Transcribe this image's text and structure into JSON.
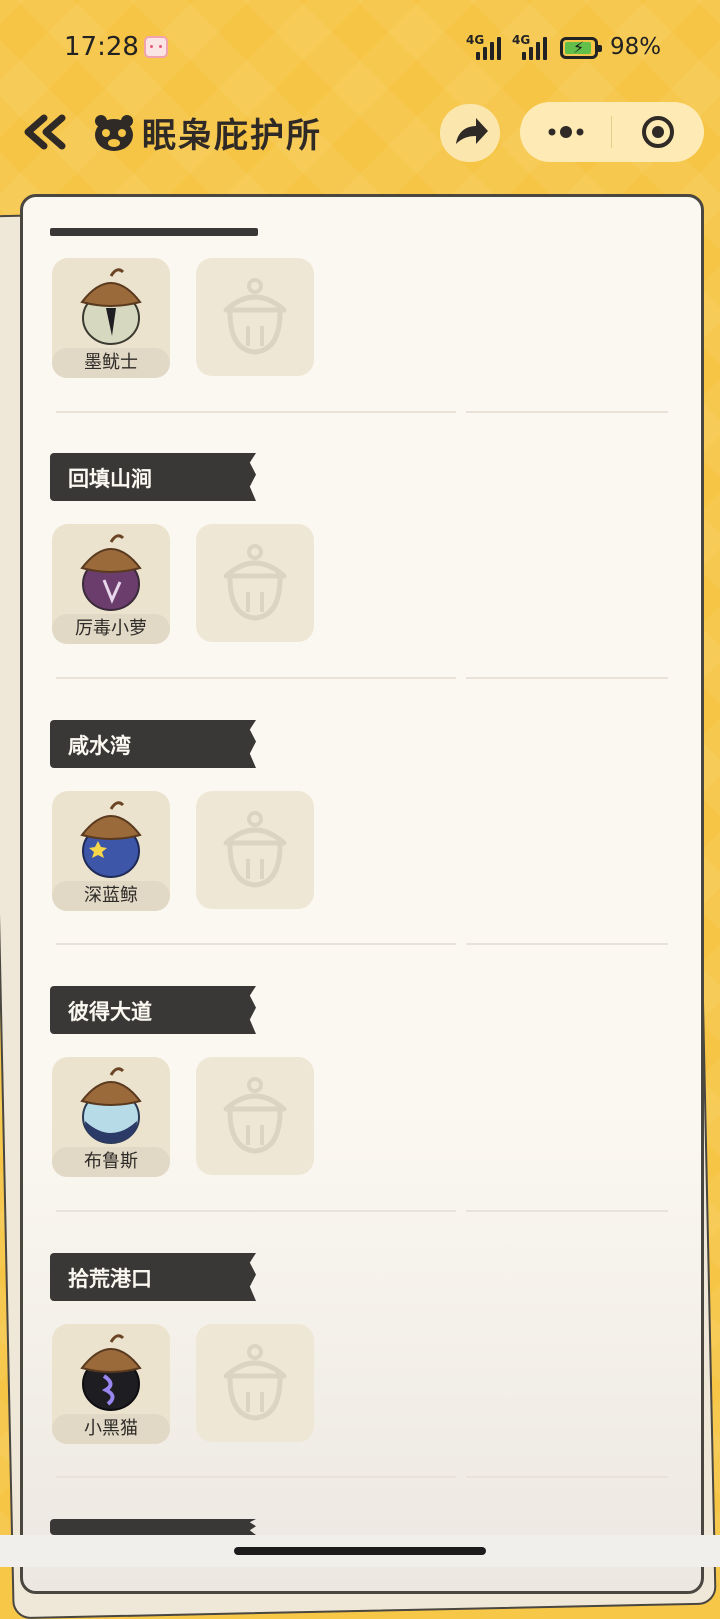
{
  "status_bar": {
    "time": "17:28",
    "net1": "4G",
    "net2": "4G",
    "battery": "98%"
  },
  "nav": {
    "title": "眠枭庇护所"
  },
  "sections": [
    {
      "title": "",
      "items": [
        {
          "name": "墨鱿士",
          "color": "#d7d8c0"
        }
      ]
    },
    {
      "title": "回填山涧",
      "items": [
        {
          "name": "厉毒小萝",
          "color": "#6b3d6d"
        }
      ]
    },
    {
      "title": "咸水湾",
      "items": [
        {
          "name": "深蓝鲸",
          "color": "#3e56a8"
        }
      ]
    },
    {
      "title": "彼得大道",
      "items": [
        {
          "name": "布鲁斯",
          "color": "#b8dbe8"
        }
      ]
    },
    {
      "title": "拾荒港口",
      "items": [
        {
          "name": "小黑猫",
          "color": "#1d1d22"
        }
      ]
    }
  ]
}
